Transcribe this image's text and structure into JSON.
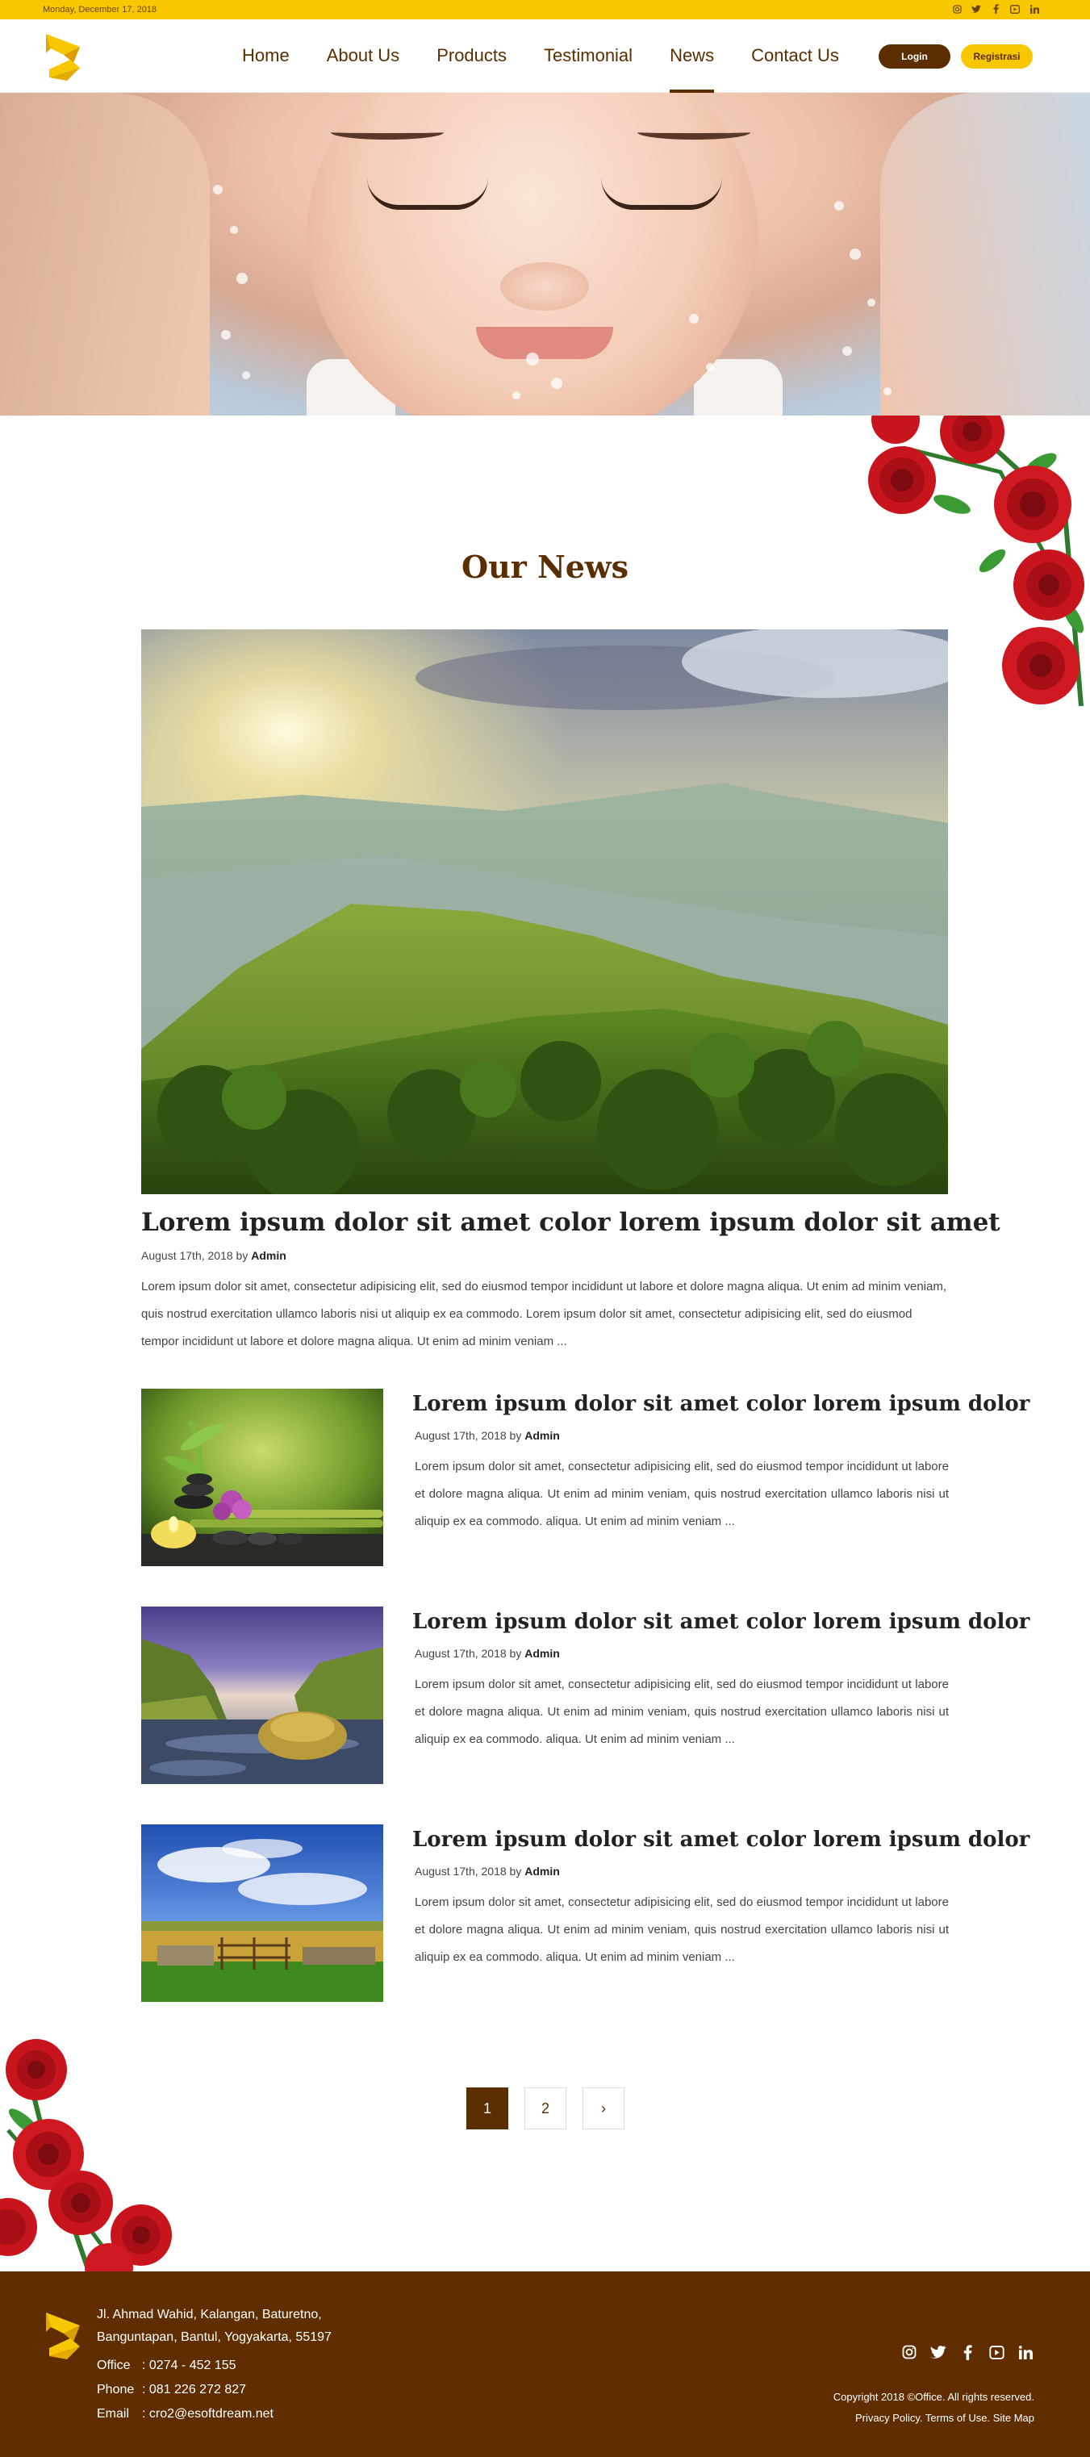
{
  "topbar": {
    "date": "Monday, December 17, 2018",
    "socials": [
      "instagram-icon",
      "twitter-icon",
      "facebook-icon",
      "youtube-icon",
      "linkedin-icon"
    ]
  },
  "nav": {
    "items": [
      {
        "label": "Home"
      },
      {
        "label": "About Us"
      },
      {
        "label": "Products"
      },
      {
        "label": "Testimonial"
      },
      {
        "label": "News",
        "active": true
      },
      {
        "label": "Contact Us"
      }
    ],
    "login": "Login",
    "register": "Registrasi"
  },
  "news": {
    "section_title": "Our News",
    "featured": {
      "title": "Lorem ipsum dolor sit amet color lorem ipsum dolor sit amet",
      "date": "August 17th, 2018",
      "by": "by",
      "author": "Admin",
      "excerpt": "Lorem ipsum dolor sit amet, consectetur adipisicing elit, sed do eiusmod tempor incididunt ut labore et dolore magna aliqua. Ut enim ad minim veniam, quis nostrud exercitation ullamco laboris nisi ut aliquip ex ea commodo. Lorem ipsum dolor sit amet, consectetur adipisicing elit, sed do eiusmod tempor incididunt ut labore et dolore magna aliqua. Ut enim ad minim veniam ..."
    },
    "items": [
      {
        "title": "Lorem ipsum dolor sit amet color lorem ipsum dolor",
        "date": "August 17th, 2018",
        "by": "by",
        "author": "Admin",
        "excerpt": "Lorem ipsum dolor sit amet, consectetur adipisicing elit, sed do eiusmod tempor incididunt ut labore et dolore magna aliqua. Ut enim ad minim veniam, quis nostrud exercitation ullamco laboris nisi ut aliquip ex ea commodo. aliqua. Ut enim ad minim veniam ..."
      },
      {
        "title": "Lorem ipsum dolor sit amet color lorem ipsum dolor",
        "date": "August 17th, 2018",
        "by": "by",
        "author": "Admin",
        "excerpt": "Lorem ipsum dolor sit amet, consectetur adipisicing elit, sed do eiusmod tempor incididunt ut labore et dolore magna aliqua. Ut enim ad minim veniam, quis nostrud exercitation ullamco laboris nisi ut aliquip ex ea commodo. aliqua. Ut enim ad minim veniam ..."
      },
      {
        "title": "Lorem ipsum dolor sit amet color lorem ipsum dolor",
        "date": "August 17th, 2018",
        "by": "by",
        "author": "Admin",
        "excerpt": "Lorem ipsum dolor sit amet, consectetur adipisicing elit, sed do eiusmod tempor incididunt ut labore et dolore magna aliqua. Ut enim ad minim veniam, quis nostrud exercitation ullamco laboris nisi ut aliquip ex ea commodo. aliqua. Ut enim ad minim veniam ..."
      }
    ]
  },
  "pagination": {
    "pages": [
      "1",
      "2"
    ],
    "current": "1",
    "next": "›"
  },
  "footer": {
    "address_line1": "Jl. Ahmad Wahid, Kalangan, Baturetno,",
    "address_line2": "Banguntapan, Bantul, Yogyakarta, 55197",
    "office_label": "Office",
    "office": ": 0274 - 452 155",
    "phone_label": "Phone",
    "phone": ": 081 226 272 827",
    "email_label": "Email",
    "email": ": cro2@esoftdream.net",
    "copyright": "Copyright 2018 ©Office. All rights reserved.",
    "links": "Privacy Policy. Terms of Use. Site Map",
    "socials": [
      "instagram-icon",
      "twitter-icon",
      "facebook-icon",
      "youtube-icon",
      "linkedin-icon"
    ]
  },
  "colors": {
    "brand_brown": "#5a2e00",
    "brand_yellow": "#f9c700",
    "footer_bg": "#5f2d00"
  }
}
